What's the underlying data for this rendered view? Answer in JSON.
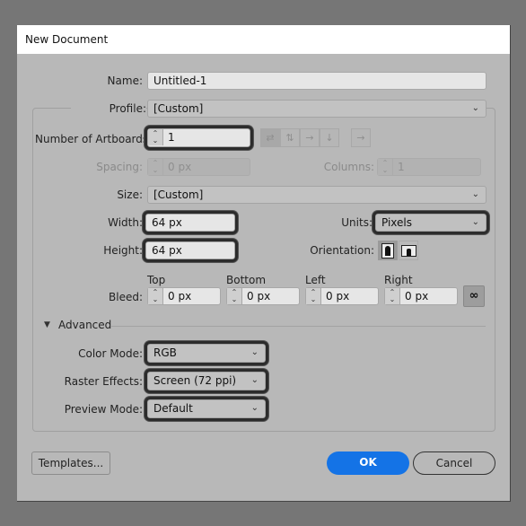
{
  "dialog": {
    "title": "New Document"
  },
  "name": {
    "label": "Name:",
    "value": "Untitled-1"
  },
  "profile": {
    "label": "Profile:",
    "value": "[Custom]"
  },
  "artboards": {
    "label": "Number of Artboards:",
    "value": "1",
    "layout_icons": [
      "grid-by-row-icon",
      "grid-by-column-icon",
      "arrange-by-row-icon",
      "arrange-by-column-icon"
    ],
    "direction_icon": "right-to-left-icon"
  },
  "spacing": {
    "label": "Spacing:",
    "value": "0 px"
  },
  "columns": {
    "label": "Columns:",
    "value": "1"
  },
  "size": {
    "label": "Size:",
    "value": "[Custom]"
  },
  "width": {
    "label": "Width:",
    "value": "64 px"
  },
  "height": {
    "label": "Height:",
    "value": "64 px"
  },
  "units": {
    "label": "Units:",
    "value": "Pixels"
  },
  "orientation": {
    "label": "Orientation:",
    "selected": "portrait"
  },
  "bleed": {
    "label": "Bleed:",
    "fields": [
      {
        "label": "Top",
        "value": "0 px"
      },
      {
        "label": "Bottom",
        "value": "0 px"
      },
      {
        "label": "Left",
        "value": "0 px"
      },
      {
        "label": "Right",
        "value": "0 px"
      }
    ],
    "link_icon": "link-icon"
  },
  "advanced": {
    "label": "Advanced",
    "color_mode": {
      "label": "Color Mode:",
      "value": "RGB"
    },
    "raster_effects": {
      "label": "Raster Effects:",
      "value": "Screen (72 ppi)"
    },
    "preview_mode": {
      "label": "Preview Mode:",
      "value": "Default"
    }
  },
  "buttons": {
    "templates": "Templates...",
    "ok": "OK",
    "cancel": "Cancel"
  },
  "colors": {
    "ok_button": "#1473e6",
    "dialog_bg": "#b8b8b8",
    "backdrop": "#767676"
  }
}
